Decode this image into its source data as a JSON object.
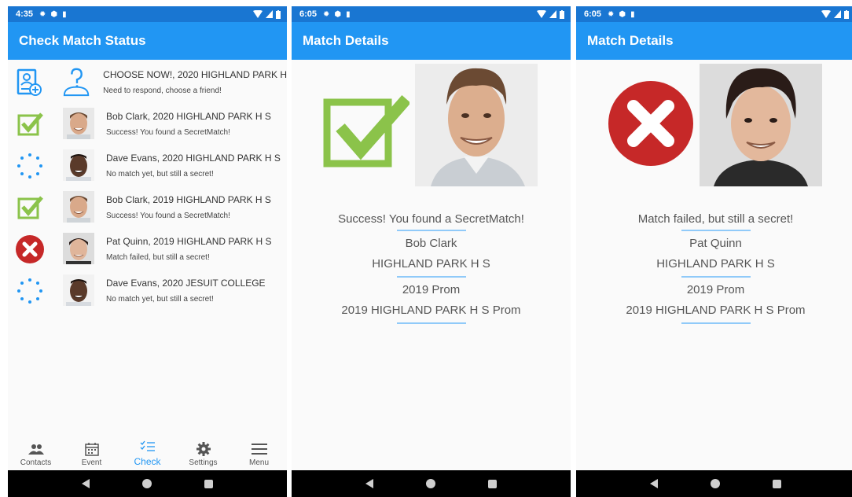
{
  "status_bar": {
    "screen1_time": "4:35",
    "screen2_time": "6:05",
    "screen3_time": "6:05"
  },
  "screen1": {
    "title": "Check Match Status",
    "rows": [
      {
        "title": "CHOOSE NOW!, 2020 HIGHLAND PARK H",
        "subtitle": "Need to respond, choose a friend!",
        "status_icon": "add-contact-icon",
        "thumb_icon": "unknown-person-icon"
      },
      {
        "title": "Bob Clark, 2020 HIGHLAND PARK H S",
        "subtitle": "Success! You found a SecretMatch!",
        "status_icon": "check-icon",
        "thumb_icon": "face-photo-icon"
      },
      {
        "title": "Dave Evans, 2020 HIGHLAND PARK H S",
        "subtitle": "No match yet, but still a secret!",
        "status_icon": "spinner-icon",
        "thumb_icon": "face-photo-icon"
      },
      {
        "title": "Bob Clark, 2019 HIGHLAND PARK H S",
        "subtitle": "Success! You found a SecretMatch!",
        "status_icon": "check-icon",
        "thumb_icon": "face-photo-icon"
      },
      {
        "title": "Pat Quinn, 2019 HIGHLAND PARK H S",
        "subtitle": "Match failed, but still a secret!",
        "status_icon": "x-icon",
        "thumb_icon": "face-photo-icon"
      },
      {
        "title": "Dave Evans, 2020 JESUIT COLLEGE",
        "subtitle": "No match yet, but still a secret!",
        "status_icon": "spinner-icon",
        "thumb_icon": "face-photo-icon"
      }
    ],
    "tabs": [
      {
        "label": "Contacts",
        "icon": "contacts-icon"
      },
      {
        "label": "Event",
        "icon": "calendar-icon"
      },
      {
        "label": "Check",
        "icon": "checklist-icon"
      },
      {
        "label": "Settings",
        "icon": "gear-icon"
      },
      {
        "label": "Menu",
        "icon": "menu-icon"
      }
    ],
    "active_tab": "Check"
  },
  "screen2": {
    "title": "Match Details",
    "message": "Success! You found a SecretMatch!",
    "name": "Bob Clark",
    "school": "HIGHLAND PARK H S",
    "event": "2019 Prom",
    "event_full": "2019 HIGHLAND PARK H S Prom"
  },
  "screen3": {
    "title": "Match Details",
    "message": "Match failed, but still a secret!",
    "name": "Pat Quinn",
    "school": "HIGHLAND PARK H S",
    "event": "2019 Prom",
    "event_full": "2019 HIGHLAND PARK H S Prom"
  },
  "colors": {
    "status_bar": "#1976d2",
    "app_bar": "#2196f3",
    "success_green": "#8bc34a",
    "fail_red": "#c62828",
    "spinner_blue": "#2196f3",
    "divider": "#90caf9"
  }
}
